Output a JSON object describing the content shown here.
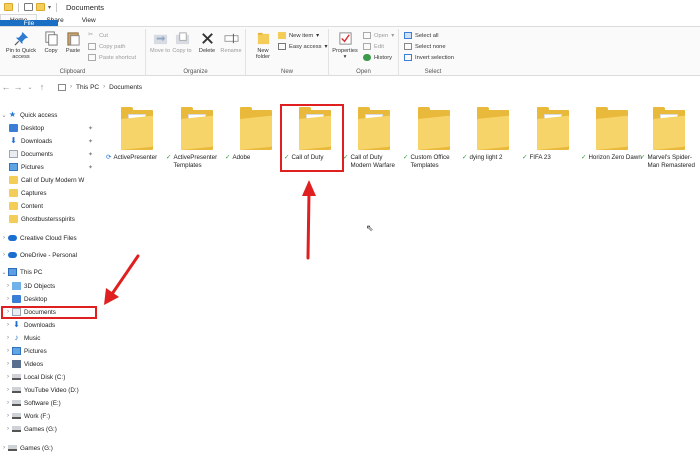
{
  "window": {
    "title": "Documents"
  },
  "ribbon_tabs": [
    "File",
    "Home",
    "Share",
    "View"
  ],
  "ribbon": {
    "clipboard": {
      "label": "Clipboard",
      "pin": "Pin to Quick access",
      "copy": "Copy",
      "paste": "Paste",
      "cut": "Cut",
      "copy_path": "Copy path",
      "paste_shortcut": "Paste shortcut"
    },
    "organize": {
      "label": "Organize",
      "move_to": "Move to",
      "copy_to": "Copy to",
      "delete": "Delete",
      "rename": "Rename"
    },
    "new": {
      "label": "New",
      "new_folder": "New folder",
      "new_item": "New item",
      "easy_access": "Easy access"
    },
    "open": {
      "label": "Open",
      "properties": "Properties",
      "open": "Open",
      "edit": "Edit",
      "history": "History"
    },
    "select": {
      "label": "Select",
      "select_all": "Select all",
      "select_none": "Select none",
      "invert": "Invert selection"
    }
  },
  "address": {
    "crumbs": [
      "This PC",
      "Documents"
    ]
  },
  "nav": {
    "quick_access": "Quick access",
    "quick_items": [
      "Desktop",
      "Downloads",
      "Documents",
      "Pictures",
      "Call of Duty  Modern W",
      "Captures",
      "Content",
      "Ghostbustersspirits"
    ],
    "creative_cloud": "Creative Cloud Files",
    "onedrive": "OneDrive - Personal",
    "this_pc": "This PC",
    "pc_items": [
      "3D Objects",
      "Desktop",
      "Documents",
      "Downloads",
      "Music",
      "Pictures",
      "Videos",
      "Local Disk (C:)",
      "YouTube Video (D:)",
      "Software (E:)",
      "Work (F:)",
      "Games (G:)"
    ],
    "games_root": "Games (G:)"
  },
  "files": [
    {
      "name": "ActivePresenter",
      "status": "sync"
    },
    {
      "name": "ActivePresenter Templates",
      "status": "ok"
    },
    {
      "name": "Adobe",
      "status": "ok"
    },
    {
      "name": "Call of Duty",
      "status": "ok"
    },
    {
      "name": "Call of Duty Modern Warfare",
      "status": "ok"
    },
    {
      "name": "Custom Office Templates",
      "status": "ok"
    },
    {
      "name": "dying light 2",
      "status": "ok"
    },
    {
      "name": "FIFA 23",
      "status": "ok"
    },
    {
      "name": "Horizon Zero Dawn",
      "status": "ok"
    },
    {
      "name": "Marvel's Spider-Man Remastered",
      "status": "ok"
    }
  ],
  "colors": {
    "accent": "#1a6fc4",
    "highlight": "#e02020",
    "folder": "#f7d46a"
  }
}
